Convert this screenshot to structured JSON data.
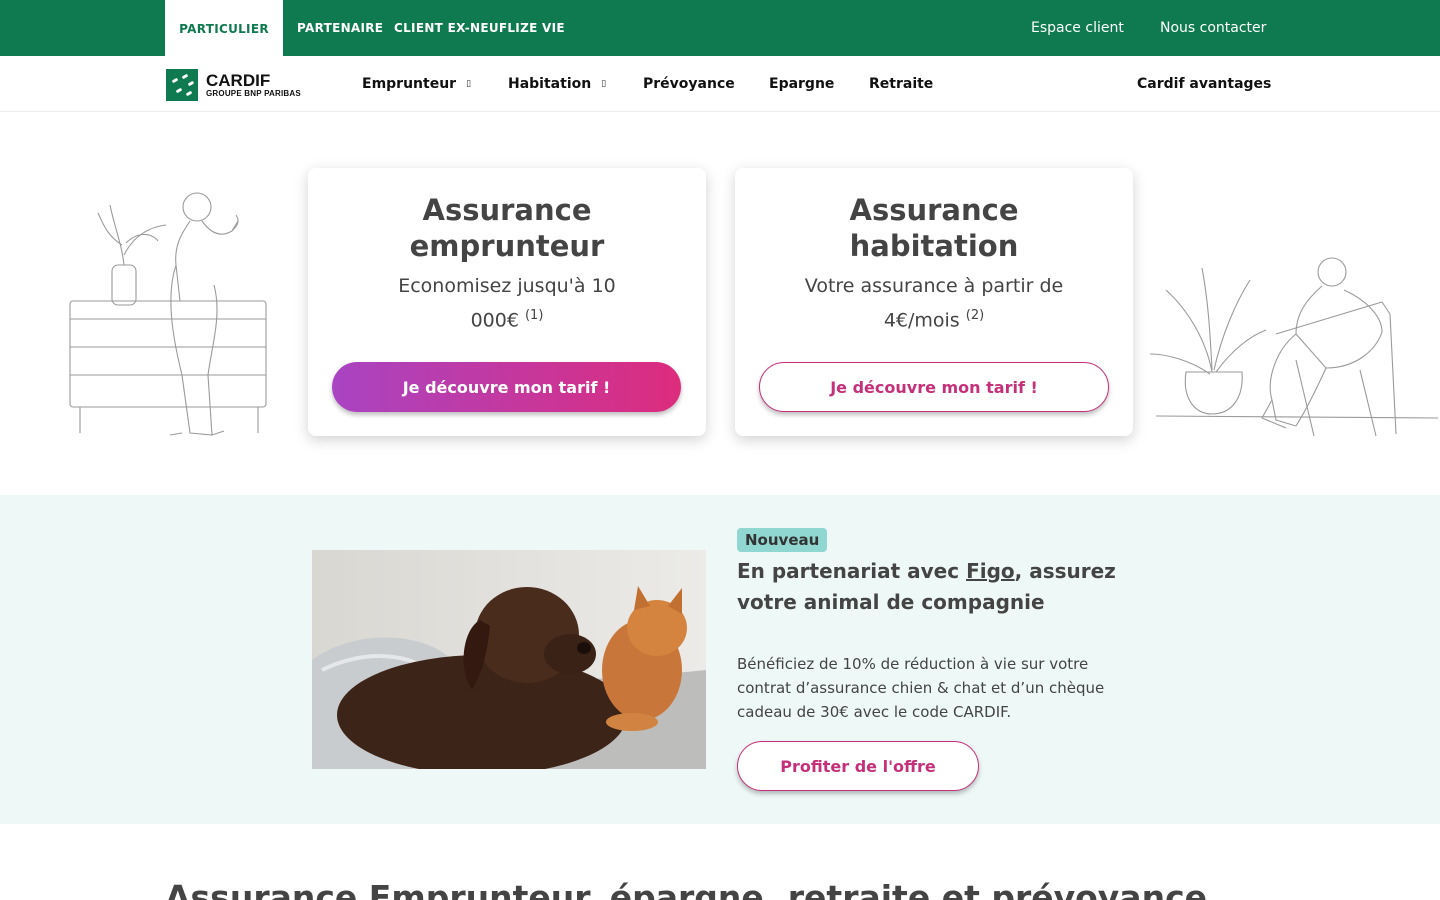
{
  "topbar": {
    "segments": [
      "PARTICULIER",
      "PARTENAIRE",
      "CLIENT EX-NEUFLIZE VIE"
    ],
    "client_space": "Espace client",
    "contact": "Nous contacter",
    "color": "#0f7a4f"
  },
  "logo": {
    "name": "CARDIF",
    "sub": "GROUPE BNP PARIBAS"
  },
  "nav": {
    "items": [
      "Emprunteur",
      "Habitation",
      "Prévoyance",
      "Epargne",
      "Retraite"
    ],
    "right_link": "Cardif avantages"
  },
  "cards": [
    {
      "title": "Assurance emprunteur",
      "text": "Economisez jusqu'à 10 000€",
      "note": "(1)",
      "cta": "Je découvre mon tarif !"
    },
    {
      "title": "Assurance habitation",
      "text": "Votre assurance à partir de 4€/mois",
      "note": "(2)",
      "cta": "Je découvre mon tarif !"
    }
  ],
  "promo": {
    "badge": "Nouveau",
    "title_before": "En partenariat avec ",
    "title_link": "Figo",
    "title_after": ", assurez votre animal de compagnie",
    "text": "Bénéficiez de 10% de réduction à vie sur votre contrat d’assurance chien & chat et d’un chèque cadeau de 30€ avec le code CARDIF.",
    "cta": "Profiter de l'offre"
  },
  "section_heading": "Assurance Emprunteur, épargne, retraite et prévoyance",
  "colors": {
    "accent": "#c6307a",
    "gradient_start": "#a944c2",
    "gradient_end": "#dd2c7d",
    "promo_bg": "#eef8f7",
    "badge_bg": "#8fd7d0"
  }
}
